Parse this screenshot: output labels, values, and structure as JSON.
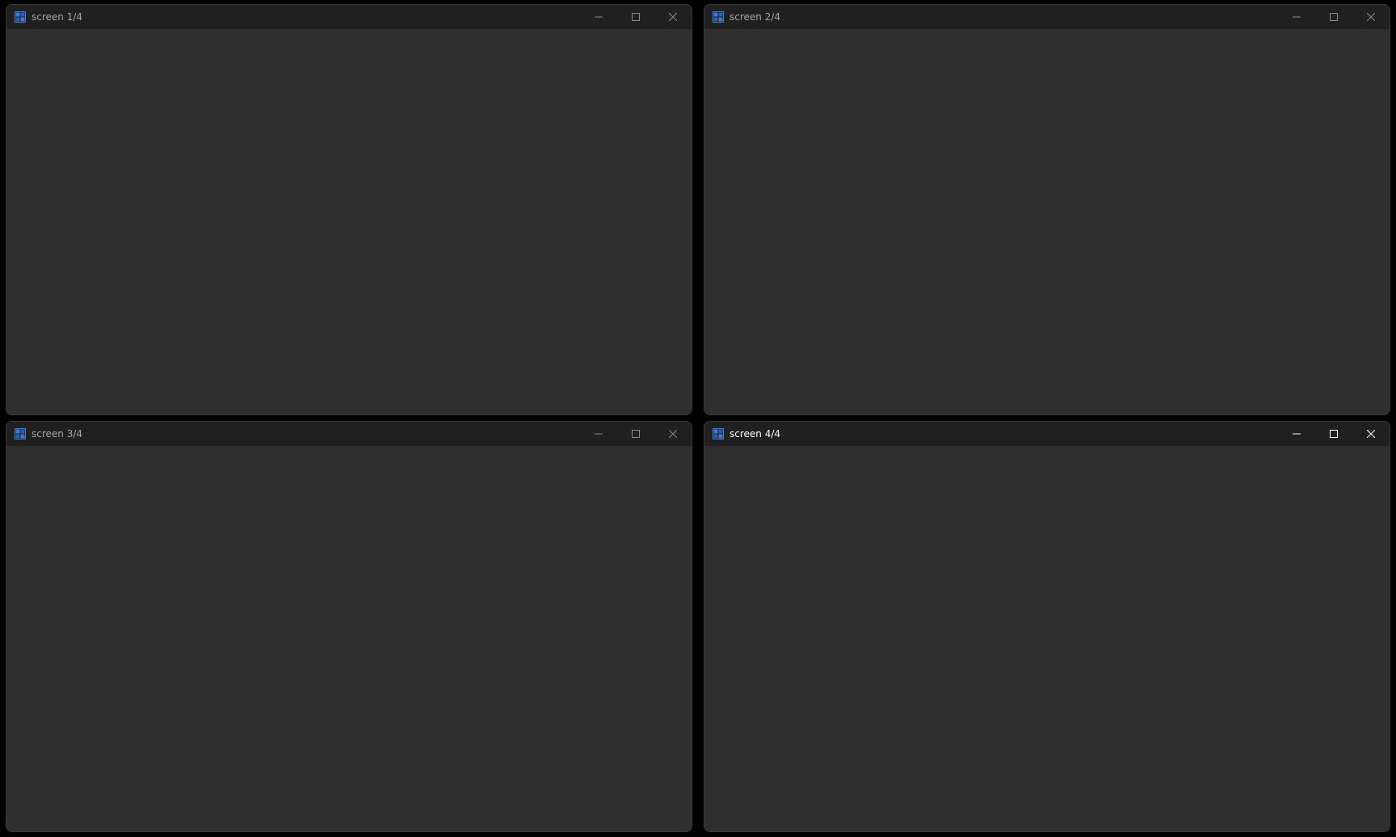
{
  "windows": [
    {
      "title": "screen 1/4",
      "active": false
    },
    {
      "title": "screen 2/4",
      "active": false
    },
    {
      "title": "screen 3/4",
      "active": false
    },
    {
      "title": "screen 4/4",
      "active": true
    }
  ],
  "icons": {
    "app": "window-grid-icon",
    "minimize": "minimize-icon",
    "maximize": "maximize-icon",
    "close": "close-icon"
  },
  "colors": {
    "desktop": "#000000",
    "titlebar": "#202020",
    "client": "#2f2f2f",
    "app_icon": "#3f7bd6",
    "inactive_text": "#a6a6a6",
    "active_text": "#ffffff"
  }
}
